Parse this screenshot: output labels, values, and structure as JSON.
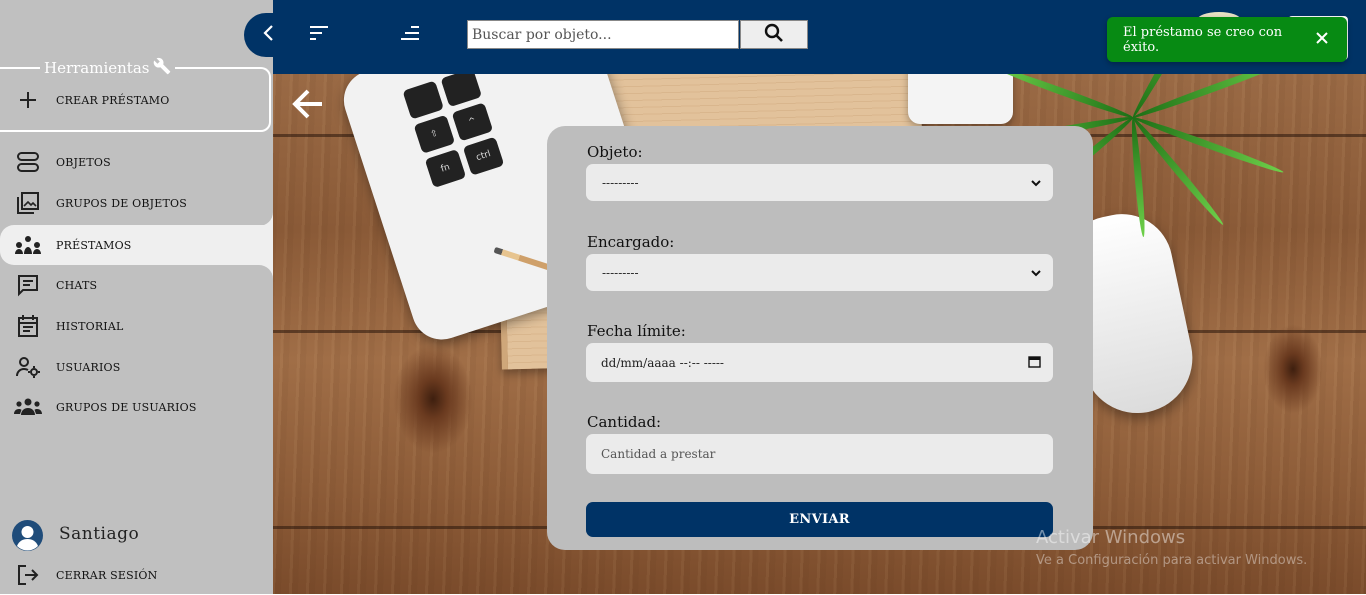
{
  "sidebar": {
    "tools_legend": "Herramientas",
    "create_loan": "CREAR PRÉSTAMO",
    "items": [
      {
        "label": "OBJETOS",
        "icon": "objects-icon"
      },
      {
        "label": "GRUPOS DE OBJETOS",
        "icon": "object-groups-icon"
      },
      {
        "label": "PRÉSTAMOS",
        "icon": "loans-icon",
        "active": true
      },
      {
        "label": "CHATS",
        "icon": "chat-icon"
      },
      {
        "label": "HISTORIAL",
        "icon": "history-icon"
      },
      {
        "label": "USUARIOS",
        "icon": "user-settings-icon"
      },
      {
        "label": "GRUPOS DE USUARIOS",
        "icon": "user-groups-icon"
      }
    ],
    "user_name": "Santiago",
    "logout": "CERRAR SESIÓN"
  },
  "topbar": {
    "search_placeholder": "Buscar por objeto...",
    "accent": "#003366"
  },
  "toast": {
    "message": "El préstamo se creo con éxito.",
    "color": "#078a13"
  },
  "form": {
    "object_label": "Objeto:",
    "object_value": "---------",
    "manager_label": "Encargado:",
    "manager_value": "---------",
    "deadline_label": "Fecha límite:",
    "deadline_value": "dd/mm/aaaa --:--  -----",
    "quantity_label": "Cantidad:",
    "quantity_placeholder": "Cantidad a prestar",
    "submit_label": "ENVIAR"
  },
  "watermark": {
    "line1": "Activar Windows",
    "line2": "Ve a Configuración para activar Windows."
  }
}
